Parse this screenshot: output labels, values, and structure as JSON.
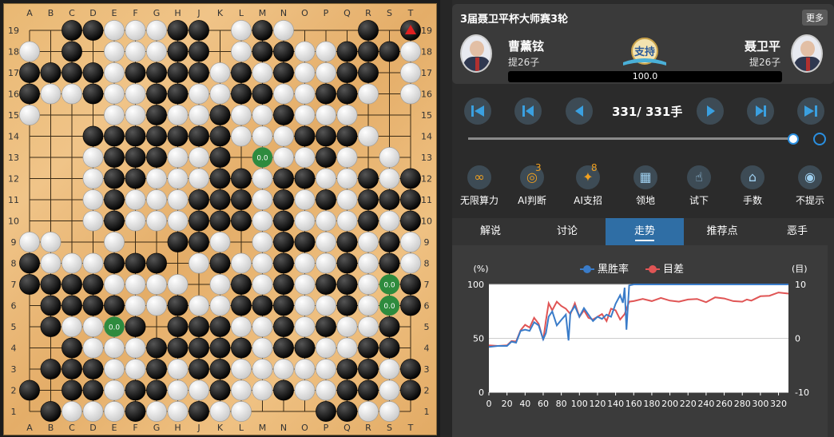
{
  "board": {
    "cols": [
      "A",
      "B",
      "C",
      "D",
      "E",
      "F",
      "G",
      "H",
      "J",
      "K",
      "L",
      "M",
      "N",
      "O",
      "P",
      "Q",
      "R",
      "S",
      "T"
    ],
    "rows": [
      "19",
      "18",
      "17",
      "16",
      "15",
      "14",
      "13",
      "12",
      "11",
      "10",
      "9",
      "8",
      "7",
      "6",
      "5",
      "4",
      "3",
      "2",
      "1"
    ],
    "stones": [
      "..BBWWWBB.WBW...B.B",
      "W.B.WWWBB.WBBWWBBBW",
      "BBBBWBBBBWBWBWWBB.W",
      "BWWBWWBBWWBBWWBBW.W",
      "W...WWBWWBWWBWWW...",
      "...BBBBBBBWWWBBBW..",
      "...WBBBWWB.WWWBW.W.",
      "...WBBWWWBBWBBWWBWB",
      "...WBWWWBBBWBWBWBBB",
      "...WBWWWBBBWBWWWBWB",
      "WW..W..BBW.WBBWBWBW",
      "BWWWBBB.WBWWBWWBWBW",
      "BBBBWWWW.WBWBWBBW.B",
      ".BBBBWWBWWBBBWWBW.B",
      ".BWWWB.BBBWWBWBWWB.",
      "..BWWWBBBBBWBBWWBB.",
      ".BBBWWBWBBWWWWWBBWB",
      "B.BBWBBWWBWWBWWBBWB",
      ".BWWWBWWBWW...BBWW."
    ],
    "markers": [
      {
        "col": 11,
        "row": 6,
        "label": "0.0"
      },
      {
        "col": 17,
        "row": 12,
        "label": "0.0"
      },
      {
        "col": 17,
        "row": 13,
        "label": "0.0"
      },
      {
        "col": 4,
        "row": 14,
        "label": "0.0"
      }
    ],
    "last_move": {
      "col": 18,
      "row": 0
    },
    "colors": {
      "marker": "#2e8b3e",
      "last_move": "#e02020"
    }
  },
  "header": {
    "title": "3届聂卫平杯大师赛3轮",
    "more_label": "更多",
    "black_player": {
      "name": "曹薰铉",
      "captures": "提26子"
    },
    "white_player": {
      "name": "聂卫平",
      "captures": "提26子"
    },
    "support_label": "支持",
    "win_rate_value": "100.0"
  },
  "nav": {
    "move_label": "331/ 331手",
    "buttons": [
      "first-move",
      "prev-10",
      "prev-move",
      "next-move",
      "next-10",
      "last-move"
    ],
    "slider_value": 1.0
  },
  "tools": [
    {
      "label": "无限算力",
      "icon": "infinite-compute-icon",
      "badge": ""
    },
    {
      "label": "AI判断",
      "icon": "ai-judge-icon",
      "badge": "3"
    },
    {
      "label": "AI支招",
      "icon": "ai-hint-icon",
      "badge": "8"
    },
    {
      "label": "领地",
      "icon": "territory-icon",
      "badge": ""
    },
    {
      "label": "试下",
      "icon": "try-move-icon",
      "badge": ""
    },
    {
      "label": "手数",
      "icon": "move-number-icon",
      "badge": ""
    },
    {
      "label": "不提示",
      "icon": "no-hint-icon",
      "badge": ""
    }
  ],
  "tabs": [
    {
      "label": "解说",
      "active": false
    },
    {
      "label": "讨论",
      "active": false
    },
    {
      "label": "走势",
      "active": true
    },
    {
      "label": "推荐点",
      "active": false
    },
    {
      "label": "恶手",
      "active": false
    }
  ],
  "chart_data": {
    "type": "line",
    "ylabel_left": "(%)",
    "ylabel_right": "(目)",
    "xticks": [
      0,
      20,
      40,
      60,
      80,
      100,
      120,
      140,
      160,
      180,
      200,
      220,
      240,
      260,
      280,
      300,
      320
    ],
    "yticks_left": [
      0,
      50,
      100
    ],
    "yticks_right": [
      -10,
      0,
      10
    ],
    "ylim_left": [
      0,
      100
    ],
    "ylim_right": [
      -10,
      10
    ],
    "xlim": [
      0,
      331
    ],
    "legend_position": "top-center",
    "series": [
      {
        "name": "黑胜率",
        "axis": "left",
        "color": "#3a7cc9",
        "x": [
          0,
          10,
          20,
          25,
          30,
          35,
          40,
          45,
          50,
          55,
          60,
          63,
          66,
          70,
          75,
          80,
          85,
          88,
          90,
          92,
          95,
          100,
          105,
          110,
          115,
          120,
          125,
          130,
          135,
          140,
          145,
          148,
          150,
          152,
          155,
          160,
          180,
          200,
          220,
          240,
          260,
          280,
          300,
          320,
          331
        ],
        "y": [
          42,
          43,
          43,
          47,
          46,
          57,
          58,
          57,
          65,
          62,
          49,
          55,
          70,
          75,
          62,
          67,
          72,
          48,
          74,
          76,
          80,
          70,
          78,
          72,
          66,
          70,
          68,
          72,
          70,
          82,
          90,
          83,
          97,
          58,
          99,
          100,
          100,
          100,
          100,
          100,
          100,
          100,
          100,
          100,
          100
        ]
      },
      {
        "name": "目差",
        "axis": "right",
        "color": "#e05555",
        "x": [
          0,
          10,
          20,
          25,
          30,
          35,
          40,
          45,
          50,
          55,
          60,
          63,
          66,
          70,
          75,
          80,
          85,
          90,
          95,
          100,
          105,
          110,
          115,
          120,
          125,
          130,
          135,
          140,
          145,
          150,
          155,
          160,
          170,
          180,
          190,
          200,
          210,
          220,
          230,
          240,
          250,
          260,
          270,
          280,
          285,
          290,
          300,
          310,
          320,
          331
        ],
        "y": [
          -1.3,
          -1.4,
          -1.3,
          -0.5,
          -0.6,
          1.5,
          2.5,
          2.0,
          3.8,
          2.7,
          -0.3,
          3.3,
          6.5,
          5.2,
          6.8,
          6.0,
          5.5,
          4.5,
          6.5,
          4.0,
          5.2,
          3.8,
          3.5,
          4.0,
          4.5,
          3.2,
          5.5,
          5.2,
          3.5,
          4.5,
          6.8,
          6.9,
          7.3,
          6.9,
          7.5,
          7.0,
          6.8,
          7.2,
          7.3,
          6.7,
          7.6,
          7.4,
          6.9,
          6.8,
          7.2,
          7.0,
          7.8,
          7.9,
          8.5,
          8.3
        ]
      }
    ]
  }
}
